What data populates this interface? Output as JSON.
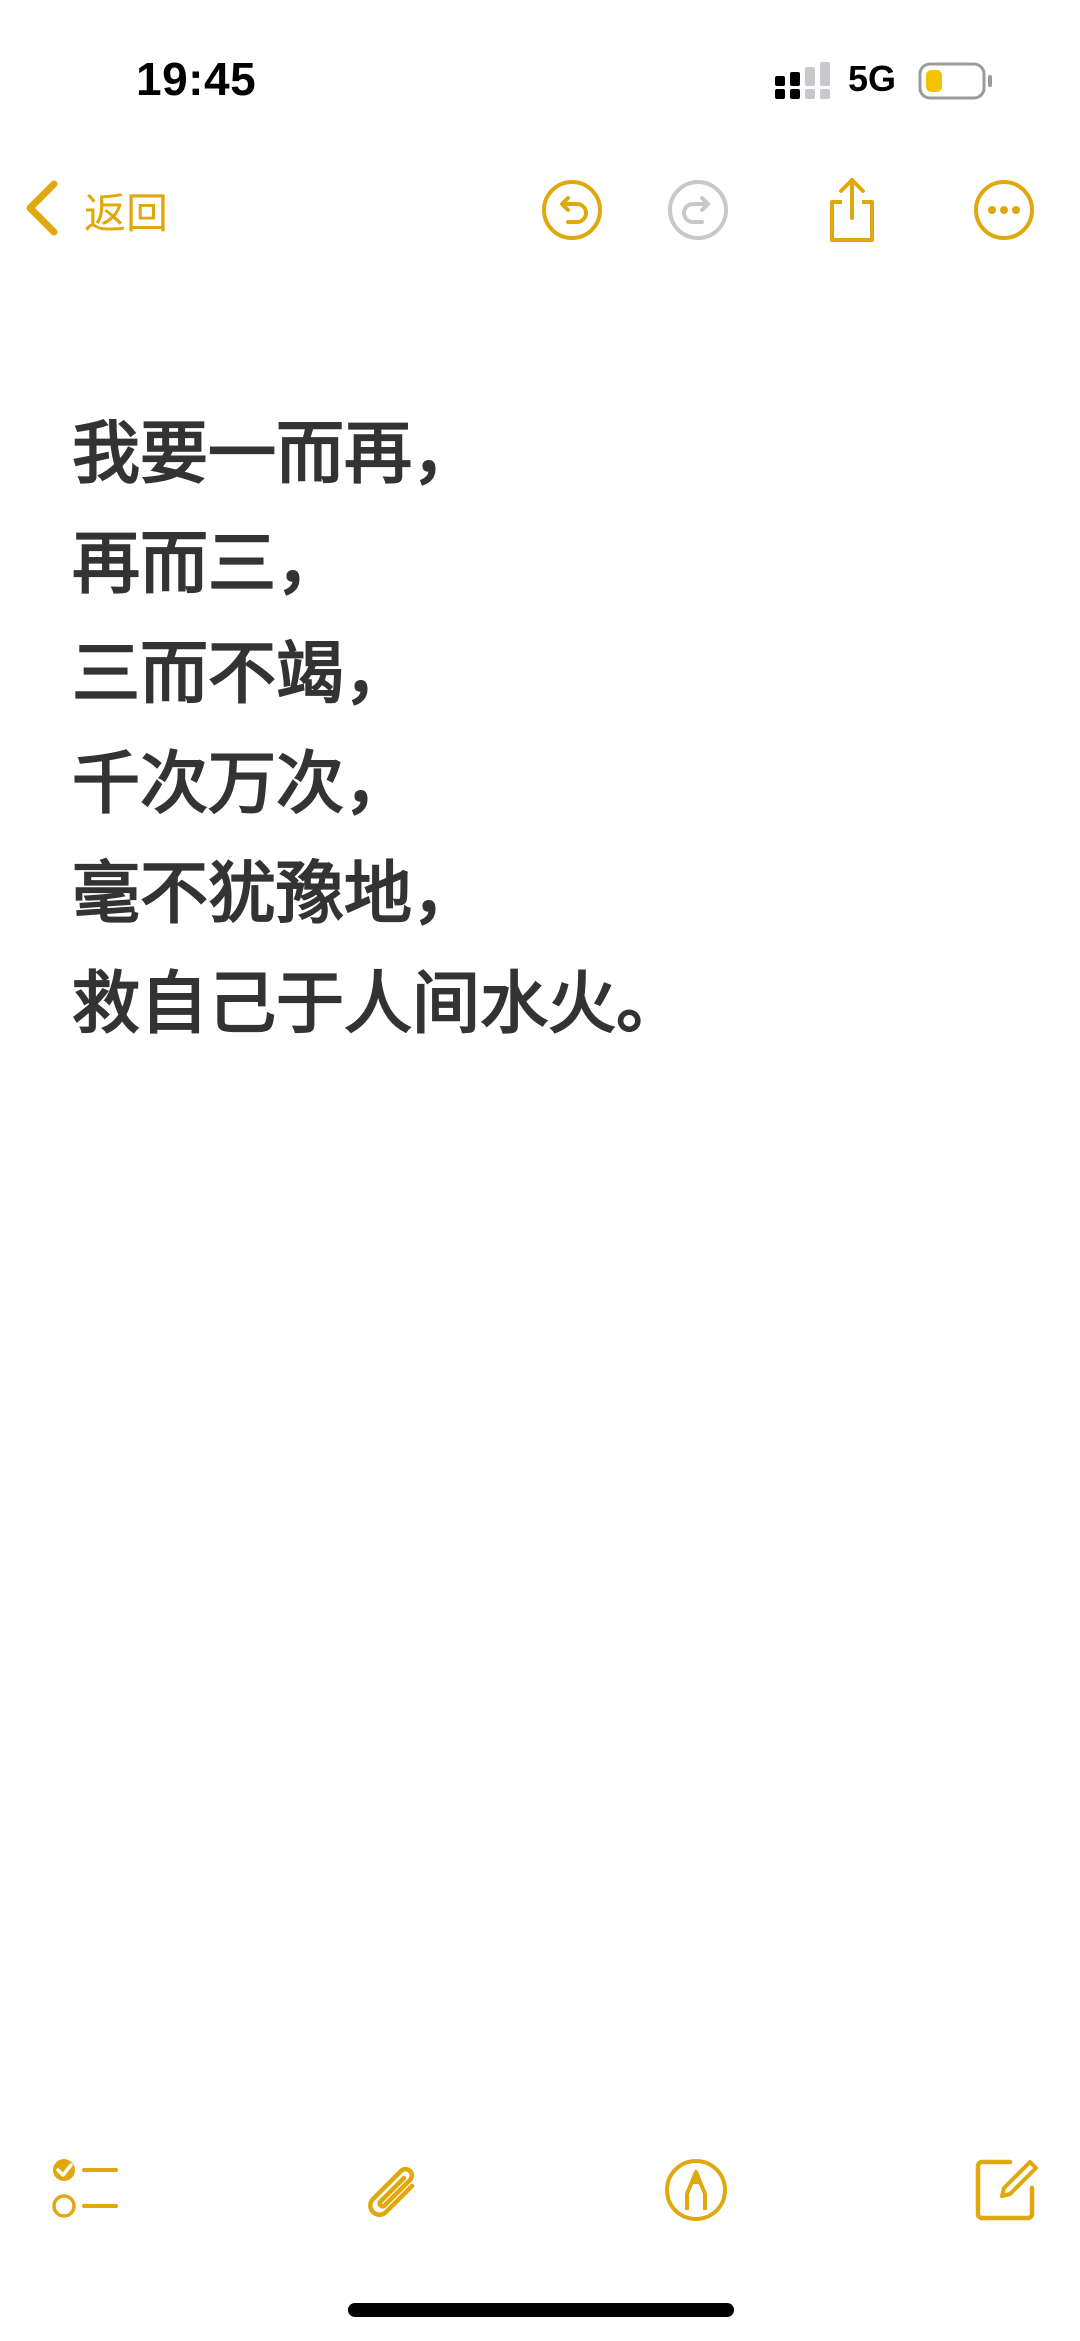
{
  "status_bar": {
    "time": "19:45",
    "network": "5G",
    "signal_icon": "cellular-signal-icon",
    "battery_icon": "battery-low-icon"
  },
  "nav": {
    "back_label": "返回",
    "icons": {
      "back": "chevron-left-icon",
      "undo": "undo-icon",
      "redo": "redo-icon",
      "share": "share-icon",
      "more": "more-icon"
    }
  },
  "note": {
    "lines": [
      "我要一而再，",
      "再而三，",
      "三而不竭，",
      "千次万次，",
      "毫不犹豫地，",
      "救自己于人间水火。"
    ]
  },
  "toolbar": {
    "icons": {
      "checklist": "checklist-icon",
      "attachment": "paperclip-icon",
      "markup": "markup-pen-icon",
      "compose": "compose-icon"
    }
  },
  "colors": {
    "accent": "#e0a80d",
    "text": "#333333",
    "disabled": "#c7c7cc",
    "battery_fill": "#f5c400"
  }
}
